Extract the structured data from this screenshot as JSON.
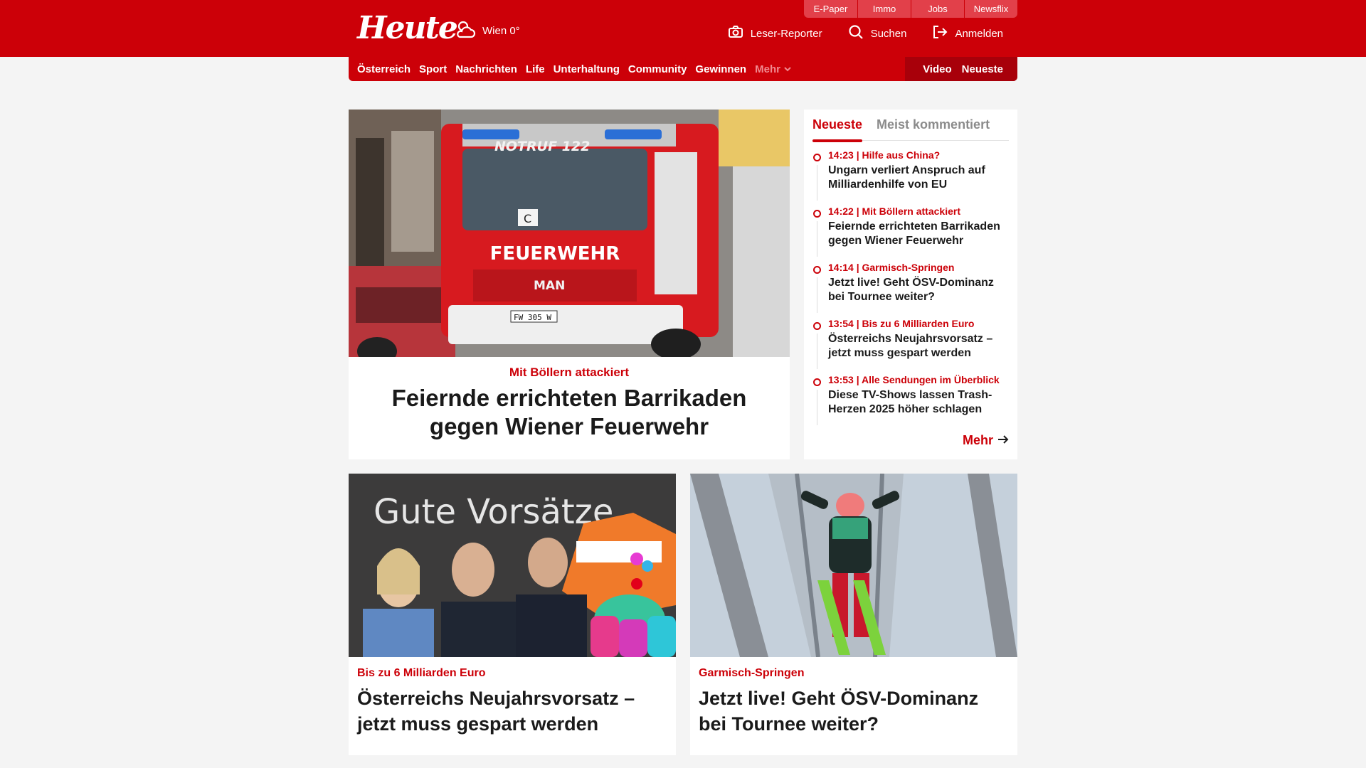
{
  "header": {
    "logo": "Heute",
    "weather": "Wien 0°",
    "mini_links": [
      "E-Paper",
      "Immo",
      "Jobs",
      "Newsflix"
    ],
    "actions": {
      "reporter": "Leser-Reporter",
      "search": "Suchen",
      "login": "Anmelden"
    }
  },
  "nav": {
    "items": [
      "Österreich",
      "Sport",
      "Nachrichten",
      "Life",
      "Unterhaltung",
      "Community",
      "Gewinnen"
    ],
    "more": "Mehr",
    "video": "Video",
    "latest": "Neueste"
  },
  "hero": {
    "kicker": "Mit Böllern attackiert",
    "title": "Feiernde errichteten Barrikaden gegen Wiener Feuerwehr",
    "image": {
      "truck_top": "NOTRUF 122",
      "truck_text": "FEUERWEHR",
      "truck_brand": "MAN",
      "plate": "FW 305 W",
      "sign": "C"
    }
  },
  "sidebar": {
    "tabs": [
      "Neueste",
      "Meist kommentiert"
    ],
    "items": [
      {
        "meta": "14:23 | Hilfe aus China?",
        "title": "Ungarn verliert Anspruch auf Milliardenhilfe von EU"
      },
      {
        "meta": "14:22 | Mit Böllern attackiert",
        "title": "Feiernde errichteten Barrikaden gegen Wiener Feuerwehr"
      },
      {
        "meta": "14:14 | Garmisch-Springen",
        "title": "Jetzt live! Geht ÖSV-Dominanz bei Tournee weiter?"
      },
      {
        "meta": "13:54 | Bis zu 6 Milliarden Euro",
        "title": "Österreichs Neujahrsvorsatz – jetzt muss gespart werden"
      },
      {
        "meta": "13:53 | Alle Sendungen im Überblick",
        "title": "Diese TV-Shows lassen Trash-Herzen 2025 höher schlagen"
      }
    ],
    "more": "Mehr"
  },
  "cards": [
    {
      "kicker": "Bis zu 6 Milliarden Euro",
      "title": "Österreichs Neujahrsvorsatz – jetzt muss gespart werden",
      "image_text": "Gute Vorsätze"
    },
    {
      "kicker": "Garmisch-Springen",
      "title": "Jetzt live! Geht ÖSV-Dominanz bei Tournee weiter?"
    }
  ],
  "colors": {
    "brand": "#cc0008",
    "brand_dark": "#a8000a",
    "background": "#f4f4f4"
  },
  "icons": [
    "cloud-sun-icon",
    "camera-icon",
    "search-icon",
    "login-icon",
    "chevron-down-icon",
    "arrow-right-icon"
  ]
}
